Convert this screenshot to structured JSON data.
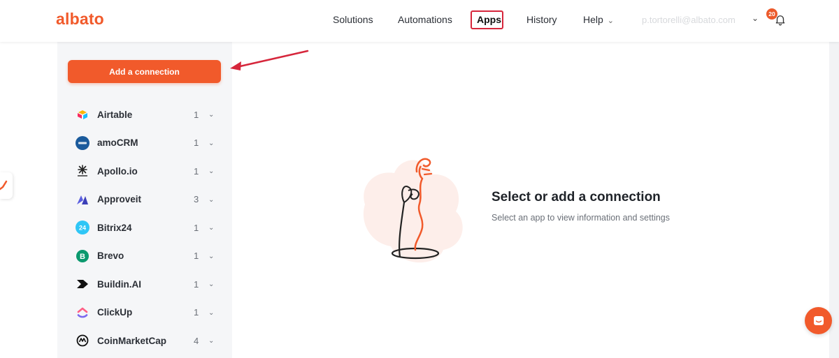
{
  "header": {
    "logo": "albato",
    "nav": [
      {
        "label": "Solutions"
      },
      {
        "label": "Automations"
      },
      {
        "label": "Apps"
      },
      {
        "label": "History"
      },
      {
        "label": "Help"
      }
    ],
    "user_email": "p.tortorelli@albato.com",
    "notification_count": "20",
    "brand_color": "#f15a2b",
    "highlight_color": "#d6263b"
  },
  "sidebar": {
    "add_button_label": "Add a connection",
    "apps": [
      {
        "name": "Airtable",
        "count": "1",
        "icon": "airtable-icon"
      },
      {
        "name": "amoCRM",
        "count": "1",
        "icon": "amocrm-icon"
      },
      {
        "name": "Apollo.io",
        "count": "1",
        "icon": "apollo-icon"
      },
      {
        "name": "Approveit",
        "count": "3",
        "icon": "approveit-icon"
      },
      {
        "name": "Bitrix24",
        "count": "1",
        "icon": "bitrix24-icon"
      },
      {
        "name": "Brevo",
        "count": "1",
        "icon": "brevo-icon"
      },
      {
        "name": "Buildin.AI",
        "count": "1",
        "icon": "buildin-icon"
      },
      {
        "name": "ClickUp",
        "count": "1",
        "icon": "clickup-icon"
      },
      {
        "name": "CoinMarketCap",
        "count": "4",
        "icon": "coinmarketcap-icon"
      }
    ]
  },
  "main": {
    "empty_title": "Select or add a connection",
    "empty_subtitle": "Select an app to view information and settings"
  }
}
